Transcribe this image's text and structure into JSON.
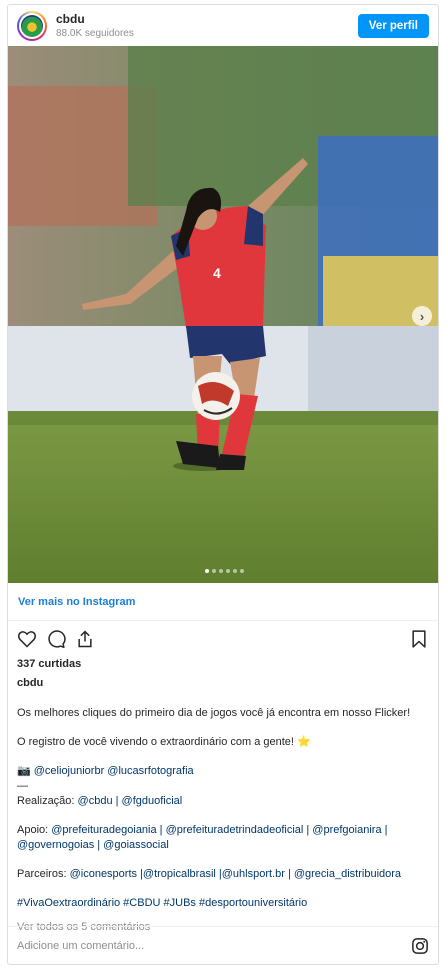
{
  "header": {
    "username": "cbdu",
    "followers": "88.0K seguidores",
    "follow_button": "Ver perfil"
  },
  "photo": {
    "carousel_dots": 6,
    "active_dot": 0
  },
  "view_more": "Ver mais no Instagram",
  "likes": "337 curtidas",
  "poster": "cbdu",
  "caption": {
    "line1": "Os melhores cliques do primeiro dia de jogos você já encontra em nosso Flicker!",
    "line2": "O registro de você vivendo o extraordinário com a gente! ⭐",
    "photo_credit_icon": "📷",
    "photo_credit": "@celiojuniorbr @lucasrfotografia",
    "separator": "—",
    "realizacao_label": "Realização:",
    "realizacao": "@cbdu | @fgduoficial",
    "apoio_label": "Apoio:",
    "apoio": "@prefeituradegoiania | @prefeituradetrindadeoficial | @prefgoianira | @governogoias | @goiassocial",
    "parceiros_label": "Parceiros:",
    "parceiros": "@iconesports |@tropicalbrasil |@uhlsport.br | @grecia_distribuidora",
    "hashtags": "#VivaOextraordinário #CBDU #JUBs #desportouniversitário"
  },
  "comments_link": "Ver todos os 5 comentários",
  "add_comment_placeholder": "Adicione um comentário...",
  "colors": {
    "accent": "#0095f6",
    "link": "#1c7fd6",
    "mention": "#00376b"
  },
  "icons": [
    "heart-icon",
    "comment-icon",
    "share-icon",
    "bookmark-icon",
    "instagram-icon",
    "chevron-right-icon"
  ]
}
